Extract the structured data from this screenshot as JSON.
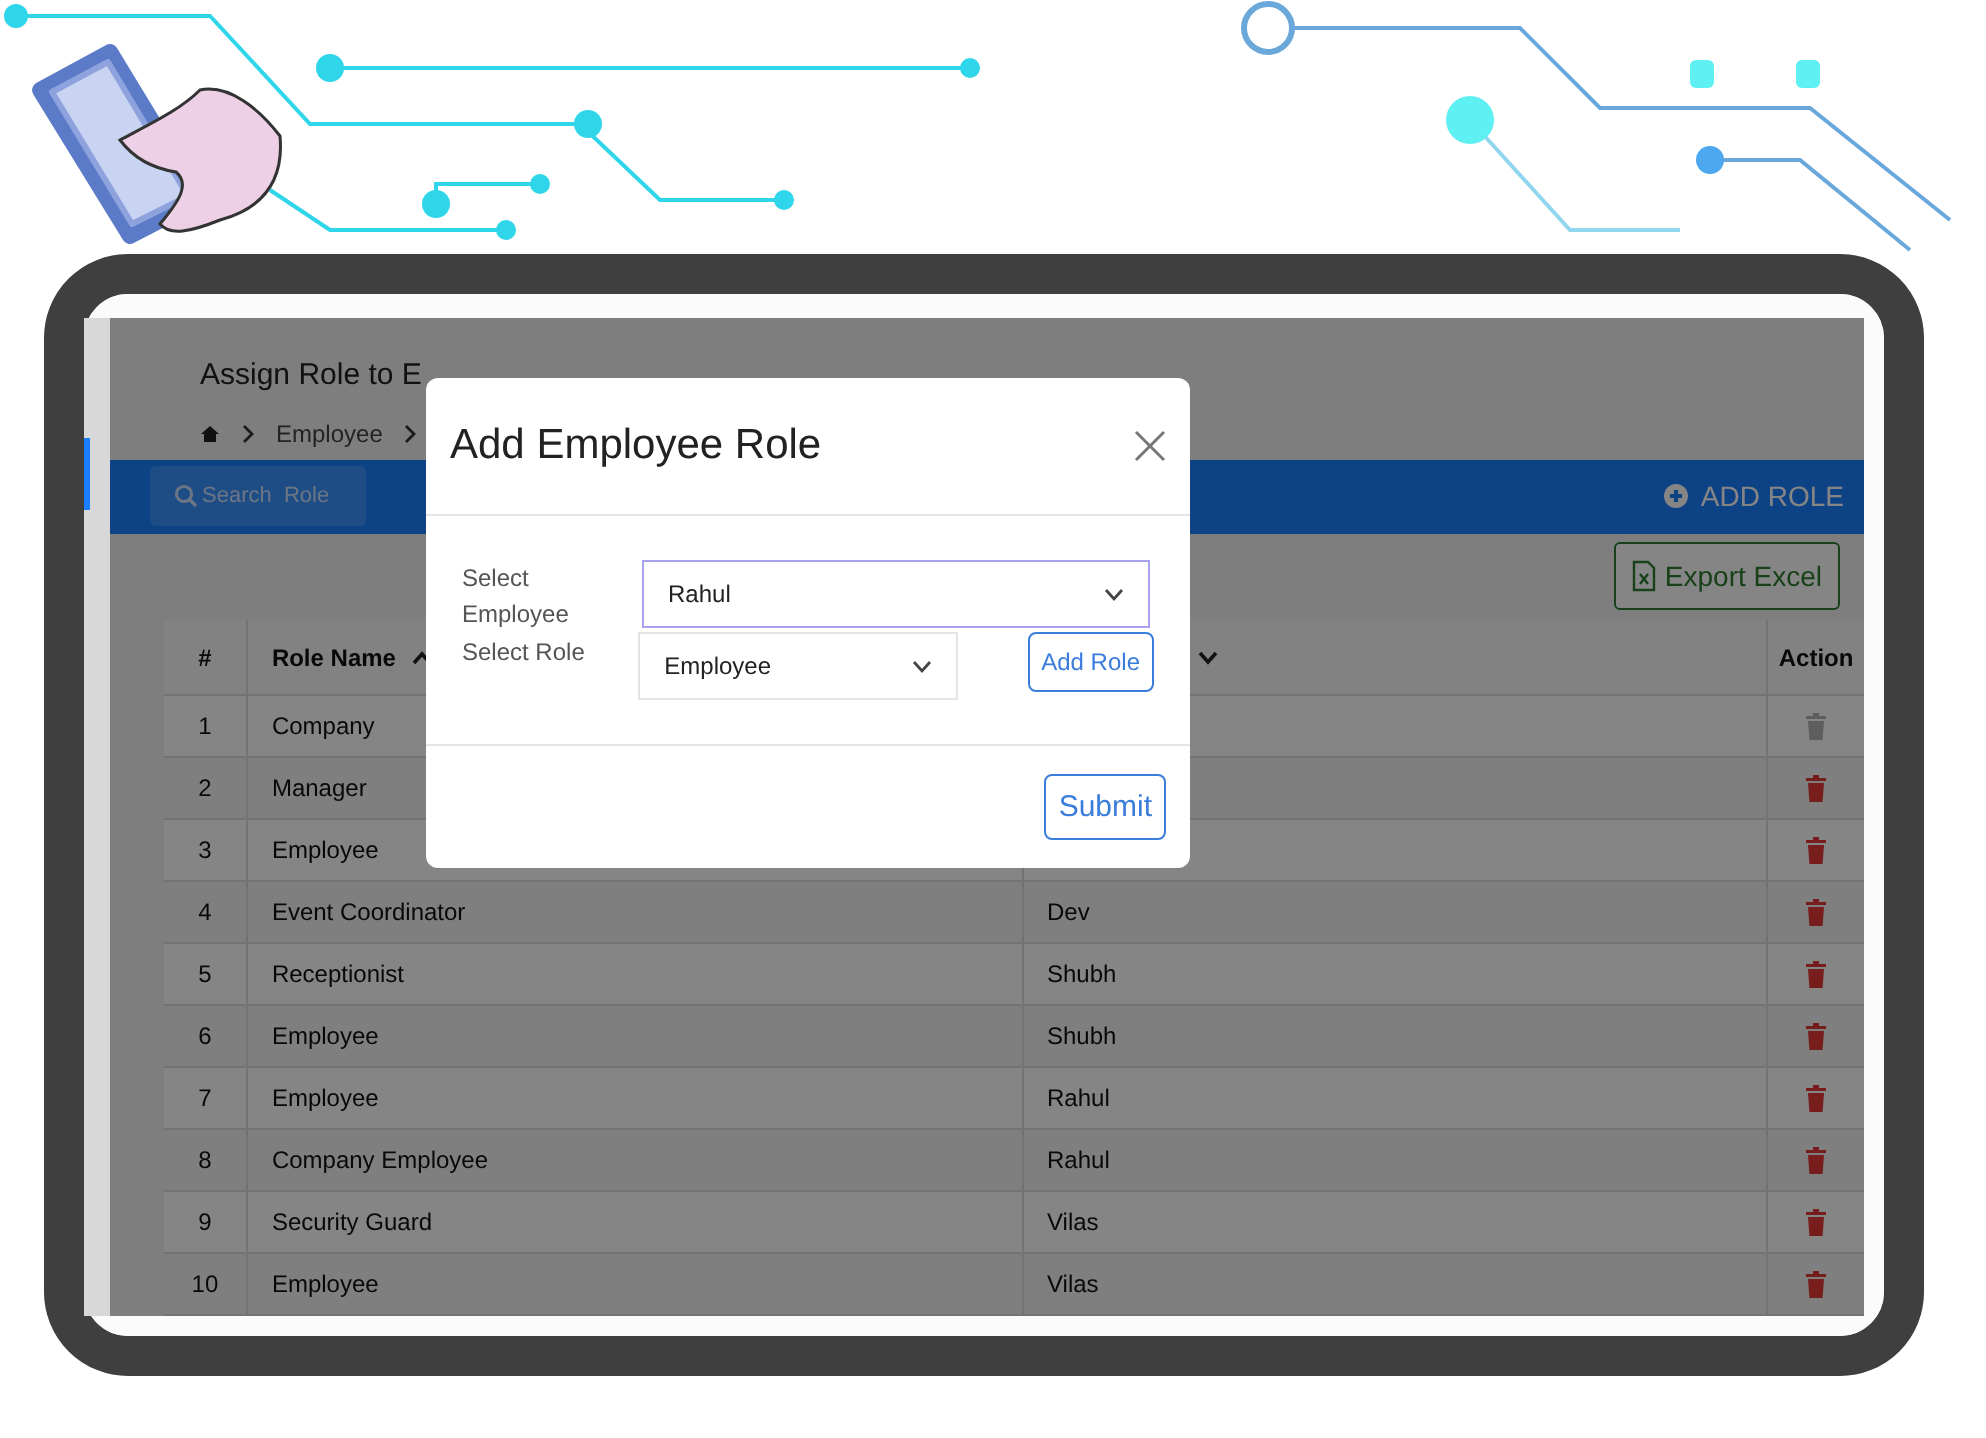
{
  "page": {
    "title": "Assign Role to E",
    "breadcrumb": [
      "Employee"
    ]
  },
  "toolbar": {
    "search_placeholder": "Search  Role",
    "add_button": "ADD ROLE",
    "export_button": "Export Excel"
  },
  "table": {
    "columns": [
      {
        "label": "#"
      },
      {
        "label": "Role Name",
        "sorted": true,
        "sort_ascending": true
      },
      {
        "sorted": true,
        "sort_ascending": false
      },
      {
        "label": "Action"
      }
    ],
    "rows": [
      {
        "number": "1",
        "role": "Company",
        "deletable": false
      },
      {
        "number": "2",
        "role": "Manager",
        "deletable": true
      },
      {
        "number": "3",
        "role": "Employee",
        "deletable": true
      },
      {
        "number": "4",
        "role": "Event Coordinator",
        "employee": "Dev",
        "deletable": true
      },
      {
        "number": "5",
        "role": "Receptionist",
        "employee": "Shubh",
        "deletable": true
      },
      {
        "number": "6",
        "role": "Employee",
        "employee": "Shubh",
        "deletable": true
      },
      {
        "number": "7",
        "role": "Employee",
        "employee": "Rahul",
        "deletable": true
      },
      {
        "number": "8",
        "role": "Company Employee",
        "employee": "Rahul",
        "deletable": true
      },
      {
        "number": "9",
        "role": "Security Guard",
        "employee": "Vilas",
        "deletable": true
      },
      {
        "number": "10",
        "role": "Employee",
        "employee": "Vilas",
        "deletable": true
      }
    ]
  },
  "modal": {
    "title": "Add Employee Role",
    "fields": [
      {
        "label": "Select Employee",
        "value": "Rahul",
        "focused": true
      },
      {
        "label": "Select Role",
        "value": "Employee",
        "focused": false
      }
    ],
    "add_role_button": "Add Role",
    "submit_button": "Submit"
  }
}
